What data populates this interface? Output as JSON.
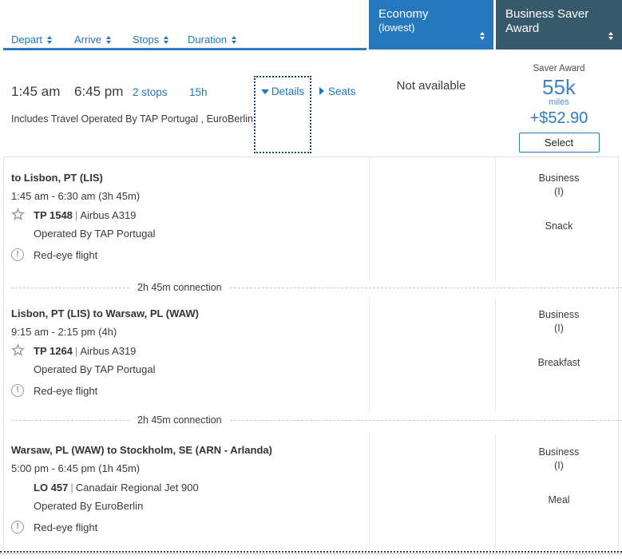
{
  "sort_bar": {
    "depart_label": "Depart",
    "arrive_label": "Arrive",
    "stops_label": "Stops",
    "duration_label": "Duration"
  },
  "fare_headers": {
    "economy_title": "Economy",
    "economy_subtitle": "(lowest)",
    "business_title": "Business Saver Award",
    "economy_bg": "#2478bb",
    "business_bg": "#37596c",
    "accent_blue": "#2175bc"
  },
  "summary": {
    "depart_time": "1:45 am",
    "arrive_time": "6:45 pm",
    "stops": "2 stops",
    "duration": "15h",
    "details_label": "Details",
    "seats_label": "Seats",
    "includes_note": "Includes Travel Operated By TAP Portugal , EuroBerlin",
    "economy_status": "Not available",
    "award": {
      "type_label": "Saver Award",
      "miles_value": "55k",
      "miles_unit": "miles",
      "cash_addon": "+$52.90",
      "select_label": "Select"
    }
  },
  "details": {
    "pipe": "|",
    "connections": [
      "2h 45m connection",
      "2h 45m connection"
    ],
    "segments": [
      {
        "route": "to Lisbon, PT (LIS)",
        "times": "1:45 am - 6:30 am (3h 45m)",
        "flight": "TP 1548",
        "aircraft": "Airbus A319",
        "operated_by": "Operated By TAP Portugal",
        "warning": "Red-eye flight",
        "cabin": "Business",
        "booking_class": "(I)",
        "meal": "Snack"
      },
      {
        "route": "Lisbon, PT (LIS) to Warsaw, PL (WAW)",
        "times": "9:15 am - 2:15 pm (4h)",
        "flight": "TP 1264",
        "aircraft": "Airbus A319",
        "operated_by": "Operated By TAP Portugal",
        "warning": "Red-eye flight",
        "cabin": "Business",
        "booking_class": "(I)",
        "meal": "Breakfast"
      },
      {
        "route": "Warsaw, PL (WAW) to Stockholm, SE (ARN - Arlanda)",
        "times": "5:00 pm - 6:45 pm (1h 45m)",
        "flight": "LO 457",
        "aircraft": "Canadair Regional Jet 900",
        "operated_by": "Operated By EuroBerlin",
        "warning": "Red-eye flight",
        "cabin": "Business",
        "booking_class": "(I)",
        "meal": "Meal"
      }
    ]
  }
}
